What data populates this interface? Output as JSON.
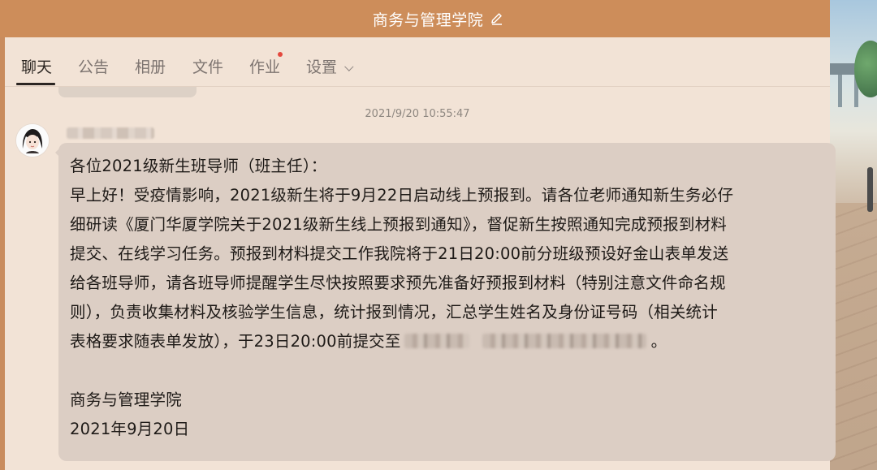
{
  "window": {
    "title": "商务与管理学院",
    "accent_color": "#cd8d5a",
    "edit_icon": "pencil-icon"
  },
  "tabs": [
    {
      "label": "聊天",
      "active": true
    },
    {
      "label": "公告",
      "active": false
    },
    {
      "label": "相册",
      "active": false
    },
    {
      "label": "文件",
      "active": false
    },
    {
      "label": "作业",
      "active": false,
      "has_badge": true
    },
    {
      "label": "设置",
      "active": false,
      "has_dropdown": true
    }
  ],
  "chat": {
    "timestamp": "2021/9/20 10:55:47",
    "message": {
      "lines": {
        "l1": "各位2021级新生班导师（班主任）：",
        "l2": "早上好！受疫情影响，2021级新生将于9月22日启动线上预报到。请各位老师通知新生务必仔",
        "l3": "细研读《厦门华厦学院关于2021级新生线上预报到通知》，督促新生按照通知完成预报到材料",
        "l4": "提交、在线学习任务。预报到材料提交工作我院将于21日20:00前分班级预设好金山表单发送",
        "l5": "给各班导师，请各班导师提醒学生尽快按照要求预先准备好预报到材料（特别注意文件命名规",
        "l6": "则），负责收集材料及核验学生信息，统计报到情况，汇总学生姓名及身份证号码（相关统计",
        "l7_before": "表格要求随表单发放），于23日20:00前提交至",
        "l7_after": "。",
        "sign_org": "商务与管理学院",
        "sign_date": "2021年9月20日"
      }
    }
  }
}
